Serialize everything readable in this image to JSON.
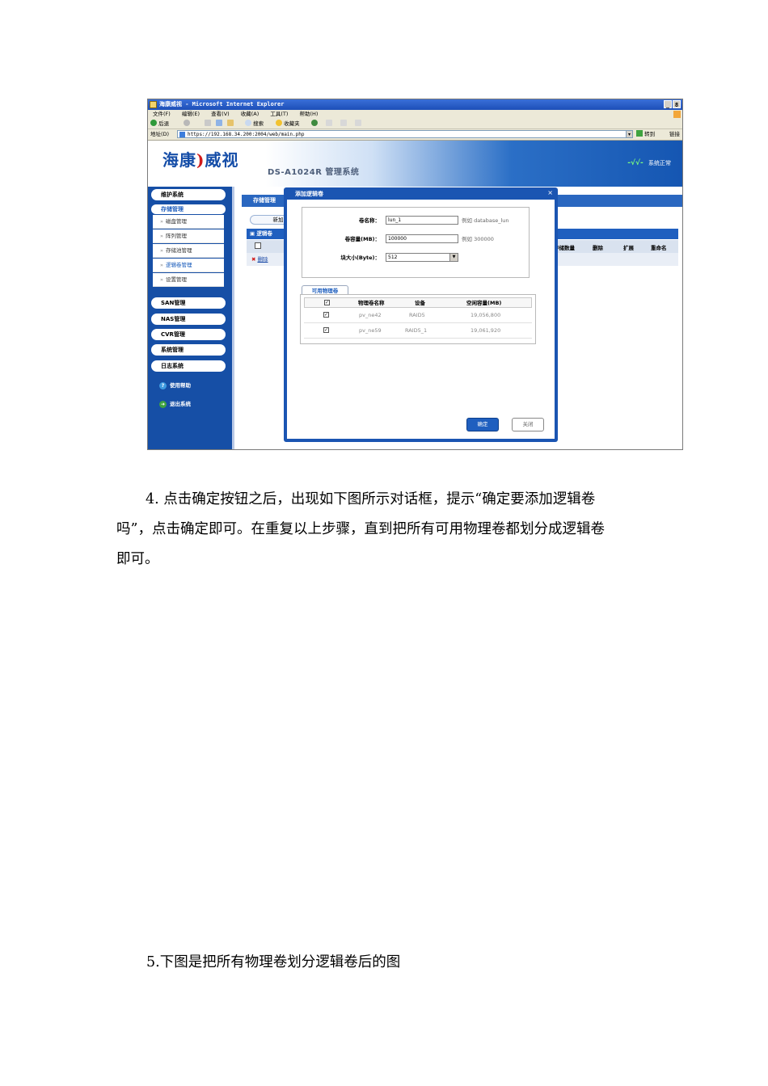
{
  "screenshot": {
    "window_title": "海康威视 - Microsoft Internet Explorer",
    "window_buttons": [
      "_",
      "8"
    ],
    "menu": [
      "文件(F)",
      "编辑(E)",
      "查看(V)",
      "收藏(A)",
      "工具(T)",
      "帮助(H)"
    ],
    "toolbar": {
      "back": "后退",
      "search": "搜索",
      "favorites": "收藏夹"
    },
    "address": {
      "label": "地址(D)",
      "url": "https://192.168.34.200:2004/web/main.php",
      "go": "转到",
      "links": "链接"
    },
    "banner": {
      "logo_part1": "海康",
      "logo_part2": "威视",
      "product": "DS-A1024R 管理系统",
      "status": "系统正常"
    },
    "sidebar": {
      "groups": [
        "维护系统",
        "存储管理"
      ],
      "sub_items": [
        "磁盘管理",
        "阵列管理",
        "存储池管理",
        "逻辑卷管理",
        "设置管理"
      ],
      "groups2": [
        "SAN管理",
        "NAS管理",
        "CVR管理",
        "系统管理",
        "日志系统"
      ],
      "help": "使用帮助",
      "logout": "退出系统"
    },
    "content": {
      "header": "存储管理",
      "add_button": "新加",
      "table_title": "逻辑卷",
      "columns": [
        "存储数量",
        "删除",
        "扩展",
        "重命名"
      ],
      "delete": "删除"
    },
    "dialog": {
      "title": "添加逻辑卷",
      "close": "×",
      "name_label": "卷名称：",
      "name_value": "lun_1",
      "name_hint": "例如 database_lun",
      "size_label": "卷容量(MB)：",
      "size_value": "100000",
      "size_hint": "例如 300000",
      "block_label": "块大小(Byte)：",
      "block_value": "512",
      "tab": "可用物理卷",
      "pv_headers": [
        "物理卷名称",
        "设备",
        "空闲容量(MB)"
      ],
      "pv_rows": [
        {
          "name": "pv_ne42",
          "device": "RAID5",
          "free": "19,056,800"
        },
        {
          "name": "pv_ne59",
          "device": "RAID5_1",
          "free": "19,061,920"
        }
      ],
      "ok": "确定",
      "cancel": "关闭"
    }
  },
  "doc": {
    "para4_line1": "4. 点击确定按钮之后，出现如下图所示对话框，提示“确定要添加逻辑卷",
    "para4_line2": "吗”，点击确定即可。在重复以上步骤，直到把所有可用物理卷都划分成逻辑卷",
    "para4_line3": "即可。",
    "para5": "5.下图是把所有物理卷划分逻辑卷后的图"
  }
}
